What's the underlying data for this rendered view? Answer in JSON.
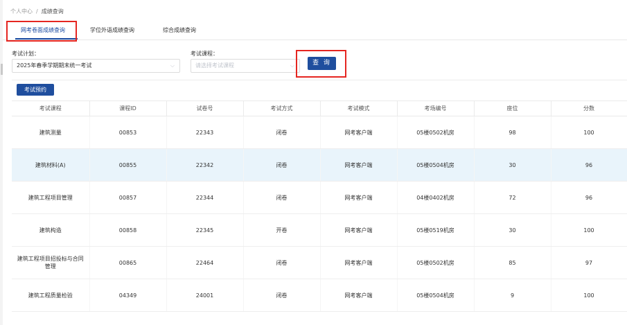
{
  "breadcrumb": {
    "root": "个人中心",
    "separator": "/",
    "current": "成绩查询"
  },
  "tabs": [
    {
      "label": "网考卷面成绩查询",
      "active": true
    },
    {
      "label": "学位外语成绩查询",
      "active": false
    },
    {
      "label": "综合成绩查询",
      "active": false
    }
  ],
  "filters": {
    "plan_label": "考试计划：",
    "plan_value": "2025年春季学期期末统一考试",
    "course_label": "考试课程：",
    "course_placeholder": "请选择考试课程"
  },
  "query_button": "查 询",
  "book_button": "考试预约",
  "table": {
    "headers": [
      "考试课程",
      "课程ID",
      "试卷号",
      "考试方式",
      "考试模式",
      "考场编号",
      "座位",
      "分数"
    ],
    "rows": [
      [
        "建筑测量",
        "00853",
        "22343",
        "闭卷",
        "网考客户端",
        "05楼0502机房",
        "98",
        "100"
      ],
      [
        "建筑材料(A)",
        "00855",
        "22342",
        "闭卷",
        "网考客户端",
        "05楼0504机房",
        "30",
        "96"
      ],
      [
        "建筑工程项目管理",
        "00857",
        "22344",
        "闭卷",
        "网考客户端",
        "04楼0402机房",
        "72",
        "96"
      ],
      [
        "建筑构造",
        "00858",
        "22345",
        "开卷",
        "网考客户端",
        "05楼0519机房",
        "30",
        "100"
      ],
      [
        "建筑工程项目招投标与合同管理",
        "00865",
        "22464",
        "闭卷",
        "网考客户端",
        "05楼0502机房",
        "85",
        "97"
      ],
      [
        "建筑工程质量检验",
        "04349",
        "24001",
        "闭卷",
        "网考客户端",
        "05楼0504机房",
        "9",
        "100"
      ]
    ]
  },
  "colors": {
    "primary": "#1f4e9e",
    "highlight_box": "#e52520",
    "row_highlight": "#e9f4fb"
  },
  "icons": {
    "select_arrow": "chevron-down-icon"
  }
}
